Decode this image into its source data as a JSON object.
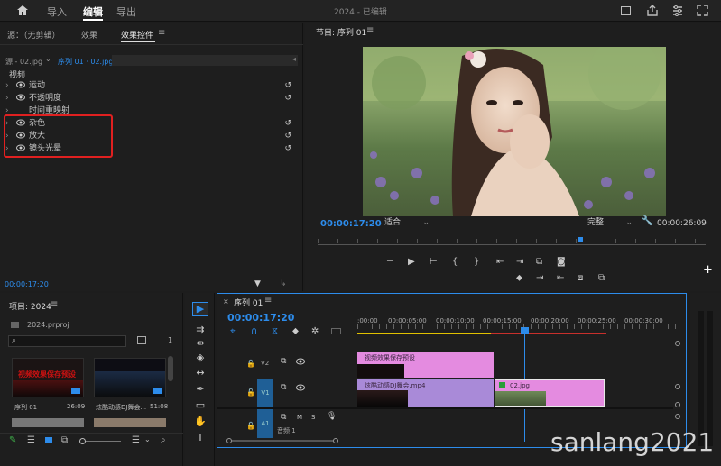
{
  "topbar": {
    "tabs": [
      "导入",
      "编辑",
      "导出"
    ],
    "active": "编辑",
    "title": "2024 - 已编辑"
  },
  "effects_panel": {
    "tabs": [
      "源：（无剪辑）",
      "效果",
      "效果控件"
    ],
    "active": "效果控件",
    "source": "源 - 02.jpg",
    "sequence": "序列 01 · 02.jpg",
    "section": "视频",
    "items": [
      "运动",
      "不透明度",
      "时间重映射",
      "杂色",
      "放大",
      "镜头光晕"
    ],
    "timecode": "00:00:17:20"
  },
  "program": {
    "title": "节目: 序列 01",
    "timecode": "00:00:17:20",
    "fit": "适合",
    "quality": "完整",
    "duration": "00:00:26:09"
  },
  "project": {
    "title": "项目: 2024",
    "file": "2024.prproj",
    "zoom_label": "1",
    "items": [
      {
        "name": "序列 01",
        "duration": "26:09",
        "overlay": "视频效果保存预设"
      },
      {
        "name": "炫酷动感DJ舞会...",
        "duration": "51:08",
        "overlay": ""
      }
    ]
  },
  "timeline": {
    "title": "序列 01",
    "timecode": "00:00:17:20",
    "ruler": [
      ":00:00",
      "00:00:05:00",
      "00:00:10:00",
      "00:00:15:00",
      "00:00:20:00",
      "00:00:25:00",
      "00:00:30:00"
    ],
    "tracks": [
      {
        "id": "V2",
        "label": "V2"
      },
      {
        "id": "V1",
        "label": "V1"
      },
      {
        "id": "A1",
        "label": "A1",
        "name": "音频 1"
      }
    ],
    "clips": [
      {
        "label": "视频效果保存预设",
        "track": "V2"
      },
      {
        "label": "炫酷动感DJ舞会.mp4",
        "track": "V1"
      },
      {
        "label": "02.jpg",
        "track": "V1"
      }
    ]
  },
  "watermark": "sanlang2021",
  "colors": {
    "accent": "#2d8ceb",
    "highlight_box": "#e02020",
    "clip_pink": "#e48be0",
    "clip_purple": "#a98ad8"
  }
}
